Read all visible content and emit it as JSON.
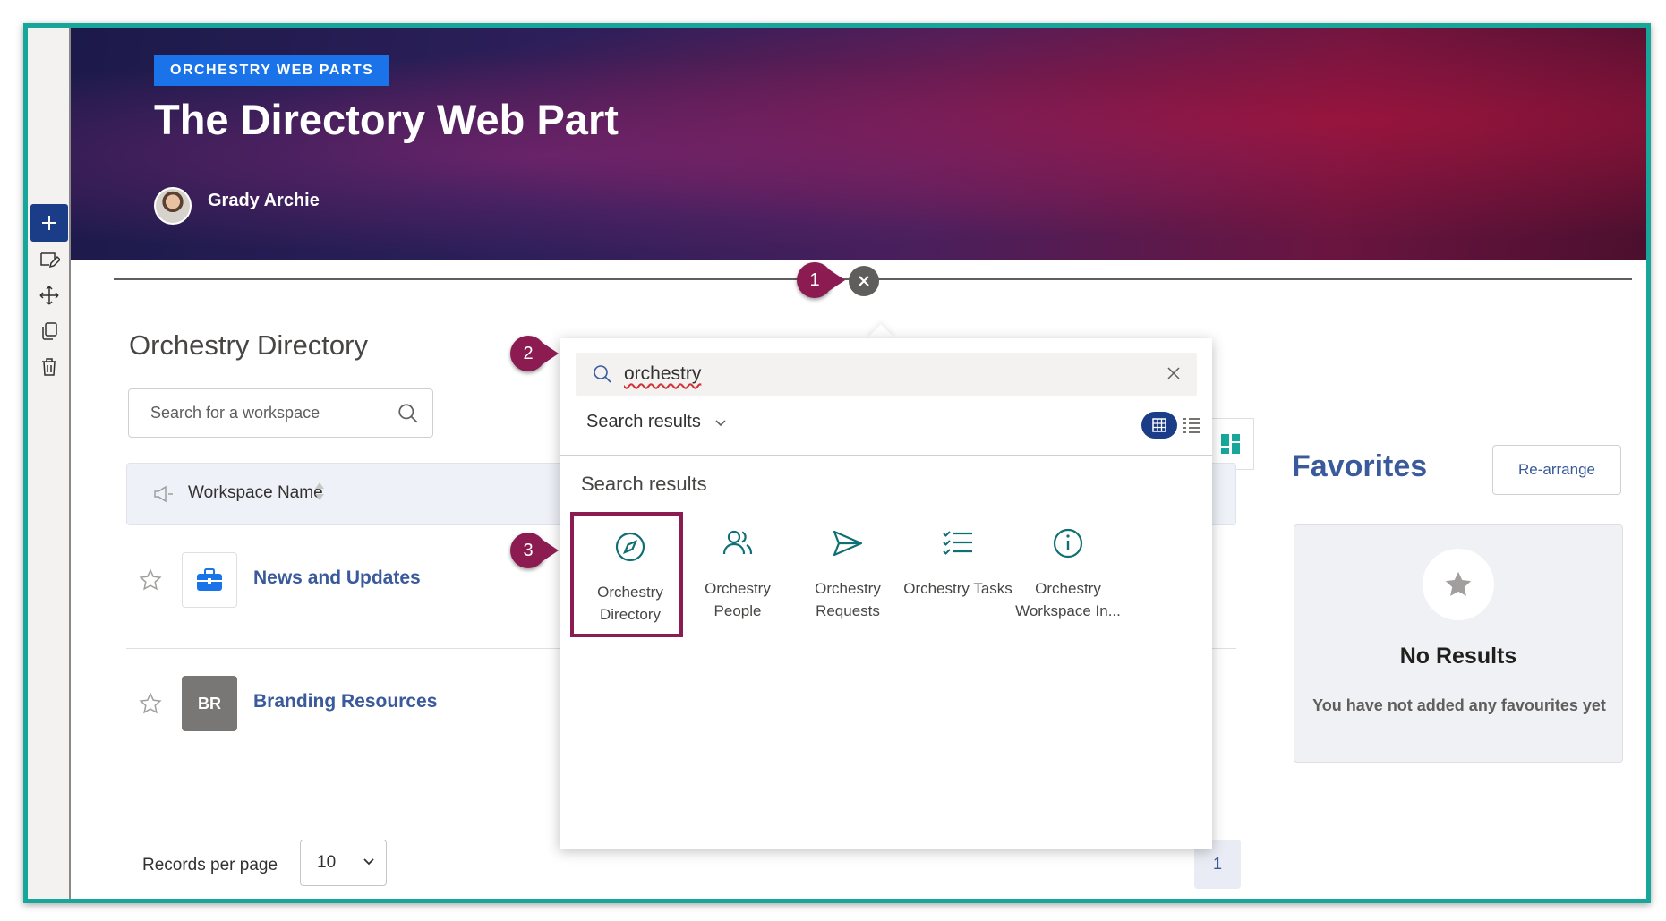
{
  "hero": {
    "badge": "ORCHESTRY WEB PARTS",
    "title": "The Directory Web Part",
    "author": "Grady Archie"
  },
  "toolbar": {
    "icons": [
      "add-icon",
      "edit-icon",
      "move-icon",
      "duplicate-icon",
      "delete-icon"
    ]
  },
  "markers": [
    "1",
    "2",
    "3"
  ],
  "directory": {
    "title": "Orchestry Directory",
    "search_placeholder": "Search for a workspace",
    "column_header": "Workspace Name",
    "rows": [
      {
        "name": "News and Updates",
        "tile": ""
      },
      {
        "name": "Branding Resources",
        "tile": "BR"
      }
    ],
    "records_per_page_label": "Records per page",
    "records_per_page_value": "10",
    "page": "1"
  },
  "favorites": {
    "title": "Favorites",
    "rearrange": "Re-arrange",
    "no_results": "No Results",
    "no_results_sub": "You have not added any favourites yet"
  },
  "picker": {
    "query": "orchestry",
    "filter": "Search results",
    "section": "Search results",
    "parts": [
      {
        "line1": "Orchestry",
        "line2": "Directory",
        "icon": "compass-icon",
        "selected": true
      },
      {
        "line1": "Orchestry",
        "line2": "People",
        "icon": "people-icon",
        "selected": false
      },
      {
        "line1": "Orchestry",
        "line2": "Requests",
        "icon": "send-icon",
        "selected": false
      },
      {
        "line1": "Orchestry Tasks",
        "line2": "",
        "icon": "tasks-icon",
        "selected": false
      },
      {
        "line1": "Orchestry",
        "line2": "Workspace In...",
        "icon": "info-icon",
        "selected": false
      }
    ]
  },
  "colors": {
    "accent": "#1b3c87",
    "marker": "#8b1b51",
    "frame": "#16a69a",
    "link": "#3a5a9c"
  }
}
